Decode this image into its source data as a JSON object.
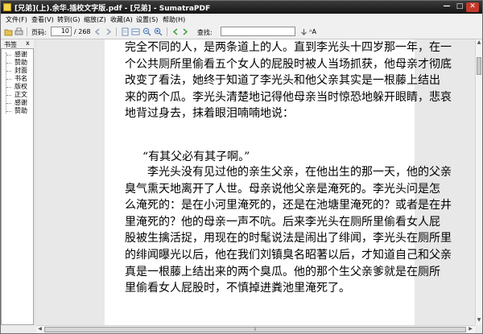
{
  "window": {
    "title": "[兄弟](上).余华.插校文字版.pdf - [兄弟] - SumatraPDF",
    "min_glyph": "—",
    "max_glyph": "□",
    "close_glyph": "✕"
  },
  "menu": [
    {
      "label": "文件(F)"
    },
    {
      "label": "查看(V)"
    },
    {
      "label": "转到(G)"
    },
    {
      "label": "缩放(Z)"
    },
    {
      "label": "收藏(A)"
    },
    {
      "label": "设置(S)"
    },
    {
      "label": "帮助(H)"
    }
  ],
  "toolbar": {
    "page_label": "页码:",
    "page_value": "10",
    "page_total": "/ 268",
    "find_label": "查找:",
    "find_value": "",
    "match_case_label": "ᴬA",
    "icons": [
      "open-icon",
      "print-icon",
      "prev-page-icon",
      "next-page-icon",
      "fit-page-icon",
      "fit-width-icon",
      "zoom-out-icon",
      "zoom-in-icon",
      "find-prev-icon",
      "find-next-icon"
    ]
  },
  "sidebar": {
    "title": "书签",
    "close_glyph": "x",
    "items": [
      {
        "label": "感谢"
      },
      {
        "label": "赞助"
      },
      {
        "label": "封面"
      },
      {
        "label": "书名"
      },
      {
        "label": "版权"
      },
      {
        "label": "正文"
      },
      {
        "label": "感谢"
      },
      {
        "label": "赞助"
      }
    ]
  },
  "document": {
    "para1": [
      "完全不同的人，是两条道上的人。直到李光头十四岁那一年，在一",
      "个公共厕所里偷看五个女人的屁股时被人当场抓获，他母亲才彻底",
      "改变了看法，她终于知道了李光头和他父亲其实是一根藤上结出",
      "来的两个瓜。李光头清楚地记得他母亲当时惊恐地躲开眼睛，悲哀",
      "地背过身去，抹着眼泪喃喃地说："
    ],
    "quote": "“有其父必有其子啊。”",
    "para2": [
      "　　李光头没有见过他的亲生父亲，在他出生的那一天，他的父亲",
      "臭气熏天地离开了人世。母亲说他父亲是淹死的。李光头问是怎",
      "么淹死的：是在小河里淹死的，还是在池塘里淹死的？或者是在井",
      "里淹死的？他的母亲一声不吭。后来李光头在厕所里偷看女人屁",
      "股被生擒活捉，用现在的时髦说法是闹出了绯闻，李光头在厕所里",
      "的绯闻曝光以后，他在我们刘镇臭名昭著以后，才知道自己和父亲",
      "真是一根藤上结出来的两个臭瓜。他的那个生父亲爹就是在厕所",
      "里偷看女人屁股时，不慎掉进粪池里淹死了。"
    ]
  },
  "scrollbar": {
    "vertical_position": 0.04,
    "horizontal_grip": "⁞"
  },
  "colors": {
    "titlebar": "#1f1f1f",
    "page_background": "#ffffff",
    "canvas_background": "#e8e8e8"
  }
}
